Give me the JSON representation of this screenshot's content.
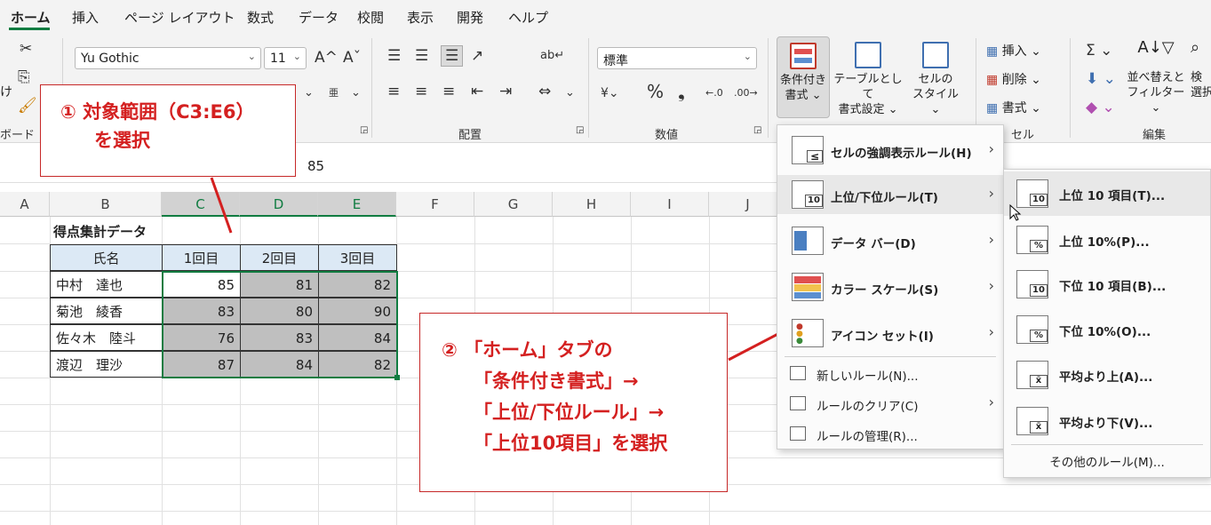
{
  "ribbon_tabs": [
    "ホーム",
    "挿入",
    "ページ レイアウト",
    "数式",
    "データ",
    "校閲",
    "表示",
    "開発",
    "ヘルプ"
  ],
  "active_tab": "ホーム",
  "ribbon": {
    "font_name": "Yu Gothic",
    "font_size": "11",
    "number_format": "標準",
    "clipboard_frag1": "け",
    "clipboard_label": "ボード",
    "alignment_label": "配置",
    "number_label": "数値",
    "cells_label": "セル",
    "editing_label": "編集",
    "cond_format_l1": "条件付き",
    "cond_format_l2": "書式 ⌄",
    "table_format_l1": "テーブルとして",
    "table_format_l2": "書式設定 ⌄",
    "cell_style_l1": "セルの",
    "cell_style_l2": "スタイル ⌄",
    "insert": "挿入",
    "delete": "削除",
    "format": "書式",
    "sort_filter_l1": "並べ替えと",
    "sort_filter_l2": "フィルター ⌄",
    "find_l1": "検",
    "find_l2": "選択"
  },
  "formula_bar_value": "85",
  "columns": [
    "A",
    "B",
    "C",
    "D",
    "E",
    "F",
    "G",
    "H",
    "I",
    "J"
  ],
  "sheet": {
    "title": "得点集計データ",
    "headers": [
      "氏名",
      "1回目",
      "2回目",
      "3回目"
    ],
    "rows": [
      {
        "name": "中村　達也",
        "v": [
          "85",
          "81",
          "82"
        ]
      },
      {
        "name": "菊池　綾香",
        "v": [
          "83",
          "80",
          "90"
        ]
      },
      {
        "name": "佐々木　陸斗",
        "v": [
          "76",
          "83",
          "84"
        ]
      },
      {
        "name": "渡辺　理沙",
        "v": [
          "87",
          "84",
          "82"
        ]
      }
    ]
  },
  "note1": {
    "line1": "① 対象範囲（C3:E6）",
    "line2": "を選択"
  },
  "note2": {
    "line1": "② 「ホーム」タブの",
    "line2": "「条件付き書式」→",
    "line3": "「上位/下位ルール」→",
    "line4": "「上位10項目」を選択"
  },
  "cf_menu": {
    "items": [
      {
        "label": "セルの強調表示ルール(H)"
      },
      {
        "label": "上位/下位ルール(T)"
      },
      {
        "label": "データ バー(D)"
      },
      {
        "label": "カラー スケール(S)"
      },
      {
        "label": "アイコン セット(I)"
      }
    ],
    "simple": [
      "新しいルール(N)...",
      "ルールのクリア(C)",
      "ルールの管理(R)..."
    ]
  },
  "sub_menu": {
    "items": [
      "上位 10 項目(T)...",
      "上位 10%(P)...",
      "下位 10 項目(B)...",
      "下位 10%(O)...",
      "平均より上(A)...",
      "平均より下(V)..."
    ],
    "icon_badges": [
      "10",
      "%",
      "10",
      "%",
      "x̄",
      "x̄"
    ],
    "more": "その他のルール(M)..."
  },
  "colors": {
    "accent": "#107c41",
    "note_red": "#d42020",
    "selection_fill": "#bfbfbf",
    "header_fill": "#dce9f5"
  }
}
